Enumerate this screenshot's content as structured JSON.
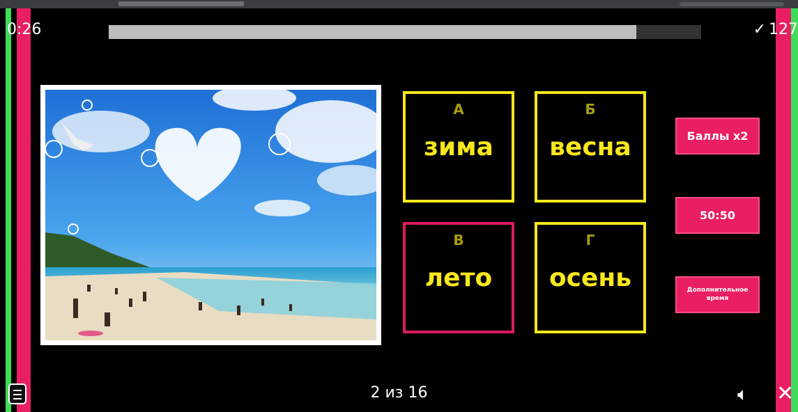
{
  "timer": "0:26",
  "progress": 0.89,
  "score": {
    "check_icon": "check-icon",
    "value": "127"
  },
  "question": {
    "image_description_icon": "beach-photo",
    "counter": "2 из 16"
  },
  "answers": [
    {
      "letter": "А",
      "word": "зима",
      "state": "default"
    },
    {
      "letter": "Б",
      "word": "весна",
      "state": "default"
    },
    {
      "letter": "В",
      "word": "лето",
      "state": "selected"
    },
    {
      "letter": "Г",
      "word": "осень",
      "state": "default"
    }
  ],
  "powerups": {
    "double_points": "Баллы x2",
    "fifty_fifty": "50:50",
    "extra_time": "Дополнительное время"
  },
  "colors": {
    "accent": "#e91e63",
    "answer_border": "#f8e71c",
    "selected_border": "#d81b60",
    "green_stripe": "#3ddc5a"
  }
}
